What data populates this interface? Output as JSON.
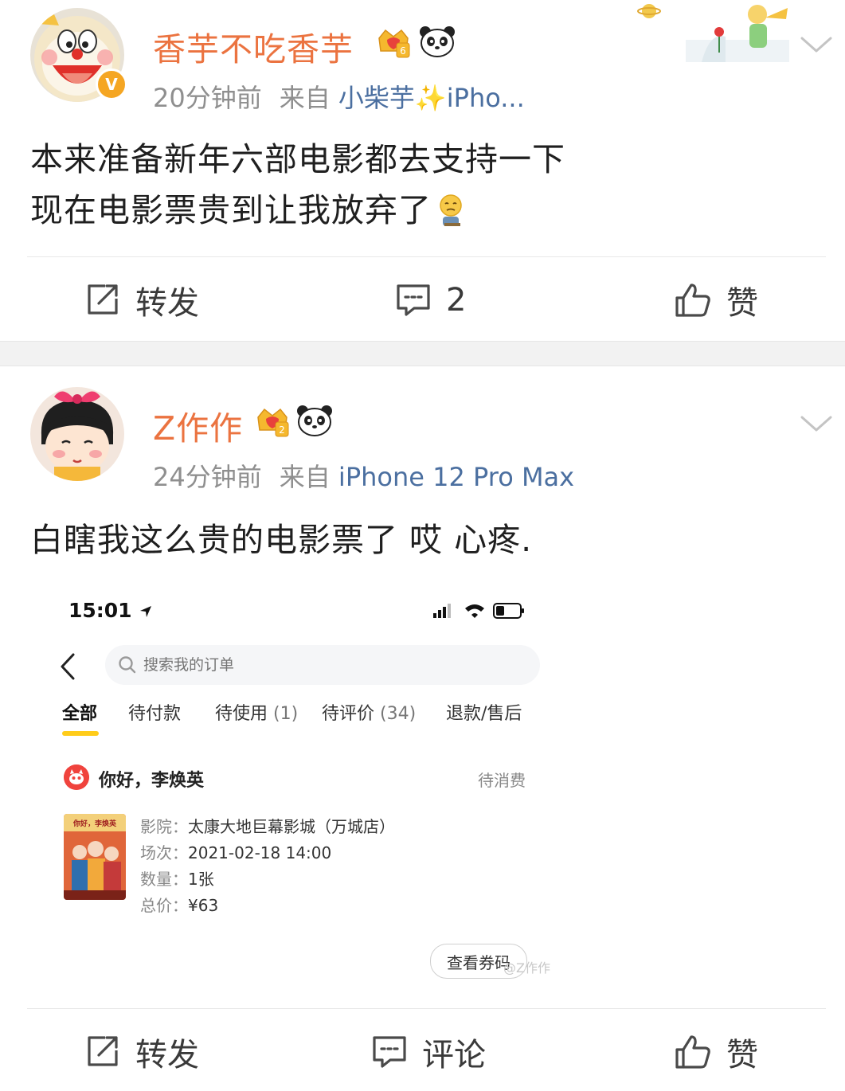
{
  "colors": {
    "username": "#eb7340",
    "source": "#4b6fa0",
    "meta": "#8f8f8f",
    "tab_accent": "#ffcc1a",
    "verified": "#f5a623"
  },
  "posts": [
    {
      "username": "香芋不吃香芋",
      "crown_level": "6",
      "time": "20分钟前",
      "from_label": "来自",
      "source": "小柴芋✨iPho...",
      "content_lines": [
        "本来准备新年六部电影都去支持一下",
        "现在电影票贵到让我放弃了"
      ],
      "verified": "V",
      "actions": {
        "repost": "转发",
        "comment": "2",
        "like": "赞"
      }
    },
    {
      "username": "Z作作",
      "crown_level": "2",
      "time": "24分钟前",
      "from_label": "来自",
      "source": "iPhone 12 Pro Max",
      "content_lines": [
        "白瞎我这么贵的电影票了 哎 心疼."
      ],
      "actions": {
        "repost": "转发",
        "comment": "评论",
        "like": "赞"
      },
      "embedded": {
        "time": "15:01",
        "search_placeholder": "搜索我的订单",
        "tabs": [
          {
            "label": "全部",
            "count": ""
          },
          {
            "label": "待付款",
            "count": ""
          },
          {
            "label": "待使用",
            "count": "(1)"
          },
          {
            "label": "待评价",
            "count": "(34)"
          },
          {
            "label": "退款/售后",
            "count": ""
          }
        ],
        "active_tab": "全部",
        "greeting": "你好，李焕英",
        "order_status": "待消费",
        "fields": [
          {
            "label": "影院：",
            "value": "太康大地巨幕影城（万城店）"
          },
          {
            "label": "场次：",
            "value": "2021-02-18 14:00"
          },
          {
            "label": "数量：",
            "value": "1张"
          },
          {
            "label": "总价：",
            "value": "¥63"
          }
        ],
        "ticket_button": "查看券码",
        "watermark": "@Z作作",
        "poster_title": "你好，李焕英"
      }
    }
  ]
}
